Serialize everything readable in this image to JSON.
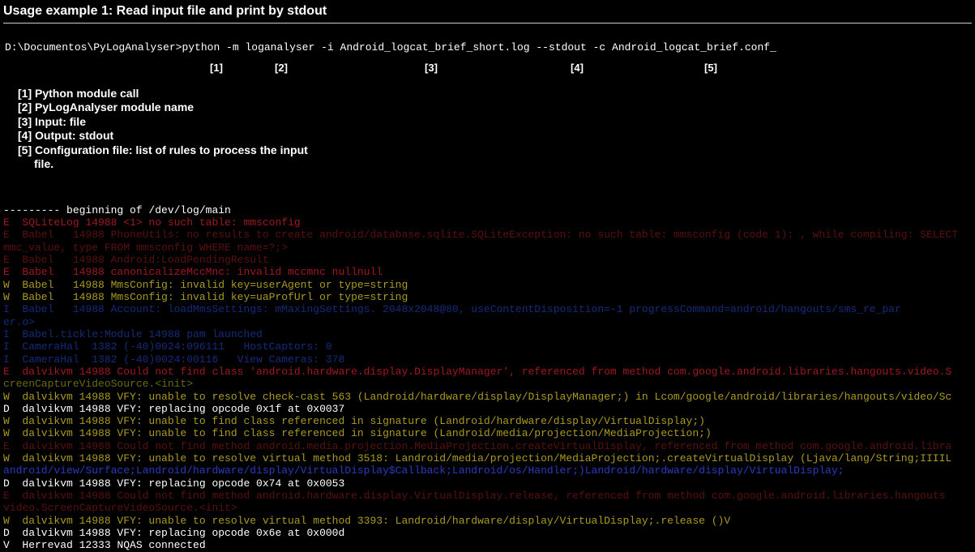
{
  "title": "Usage example 1: Read input file and print by stdout",
  "command": {
    "prompt": "D:\\Documentos\\PyLogAnalyser>",
    "part1": "python -m",
    "part2": "loganalyser",
    "part3": "-i Android_logcat_brief_short.log",
    "part4": "--stdout",
    "part5": "-c Android_logcat_brief.conf",
    "cursor": "_"
  },
  "markers": {
    "m1": "[1]",
    "m2": "[2]",
    "m3": "[3]",
    "m4": "[4]",
    "m5": "[5]"
  },
  "legend": {
    "l1": "[1] Python module call",
    "l2": "[2] PyLogAnalyser module name",
    "l3": "[3] Input: file",
    "l4": "[4] Output: stdout",
    "l5": "[5] Configuration file: list of rules to process the input",
    "l5b": "file."
  },
  "log": [
    {
      "cls": "lg-white",
      "text": "--------- beginning of /dev/log/main"
    },
    {
      "cls": "lg-red",
      "text": "E  SQLiteLog 14988 <1> no such table: mmsconfig"
    },
    {
      "cls": "lg-darkred",
      "text": "E  Babel   14988 PhoneUtils: no results to create android/database.sqlite.SQLiteException: no such table: mmsconfig (code 1): , while compiling: SELECT"
    },
    {
      "cls": "lg-darkred",
      "text": "mmc_value, type FROM mmsconfig WHERE name=?;>"
    },
    {
      "cls": "lg-darkred",
      "text": "E  Babel   14988 Android:LoadPendingResult"
    },
    {
      "cls": "lg-red",
      "text": "E  Babel   14988 canonicalizeMccMnc: invalid mccmnc nullnull"
    },
    {
      "cls": "lg-yellow",
      "text": "W  Babel   14988 MmsConfig: invalid key=userAgent or type=string"
    },
    {
      "cls": "lg-yellow",
      "text": "W  Babel   14988 MmsConfig: invalid key=uaProfUrl or type=string"
    },
    {
      "cls": "lg-dkblue",
      "text": "I  Babel   14988 Account: loadMmsSettings: mMaxingSettings. 2048x2048@80, useContentDisposition=-1 progressCommand=android/hangouts/sms_re_par"
    },
    {
      "cls": "lg-dkblue",
      "text": "er.o>"
    },
    {
      "cls": "lg-dkblue",
      "text": "I  Babel.tickle:Module 14988 pam launched"
    },
    {
      "cls": "lg-dkblue",
      "text": "I  CameraHal  1382 (-40)0024:096111   HostCaptors: 0"
    },
    {
      "cls": "lg-dkblue",
      "text": "I  CameraHal  1382 (-40)0024:00116   View Cameras: 378"
    },
    {
      "cls": "lg-red",
      "text": "E  dalvikvm 14988 Could not find class 'android.hardware.display.DisplayManager', referenced from method com.google.android.libraries.hangouts.video.S"
    },
    {
      "cls": "lg-olive",
      "text": "creenCaptureVideoSource.<init>"
    },
    {
      "cls": "lg-yellow",
      "text": "W  dalvikvm 14988 VFY: unable to resolve check-cast 563 (Landroid/hardware/display/DisplayManager;) in Lcom/google/android/libraries/hangouts/video/Sc"
    },
    {
      "cls": "lg-white",
      "text": "D  dalvikvm 14988 VFY: replacing opcode 0x1f at 0x0037"
    },
    {
      "cls": "lg-yellow",
      "text": "W  dalvikvm 14988 VFY: unable to find class referenced in signature (Landroid/hardware/display/VirtualDisplay;)"
    },
    {
      "cls": "lg-yellow",
      "text": "W  dalvikvm 14988 VFY: unable to find class referenced in signature (Landroid/media/projection/MediaProjection;)"
    },
    {
      "cls": "lg-darkred",
      "text": "E  dalvikvm 14988 Could not find method android.media.projection.MediaProjection.createVirtualDisplay, referenced from method com.google.android.libra"
    },
    {
      "cls": "lg-yellow",
      "text": "W  dalvikvm 14988 VFY: unable to resolve virtual method 3518: Landroid/media/projection/MediaProjection;.createVirtualDisplay (Ljava/lang/String;IIIIL"
    },
    {
      "cls": "lg-blue",
      "text": "android/view/Surface;Landroid/hardware/display/VirtualDisplay$Callback;Landroid/os/Handler;)Landroid/hardware/display/VirtualDisplay;"
    },
    {
      "cls": "lg-white",
      "text": "D  dalvikvm 14988 VFY: replacing opcode 0x74 at 0x0053"
    },
    {
      "cls": "lg-darkred",
      "text": "E  dalvikvm 14988 Could not find method android.hardware.display.VirtualDisplay.release, referenced from method com.google.android.libraries.hangouts"
    },
    {
      "cls": "lg-darkred",
      "text": "video.ScreenCaptureVideoSource.<init>"
    },
    {
      "cls": "lg-yellow",
      "text": "W  dalvikvm 14988 VFY: unable to resolve virtual method 3393: Landroid/hardware/display/VirtualDisplay;.release ()V"
    },
    {
      "cls": "lg-white",
      "text": "D  dalvikvm 14988 VFY: replacing opcode 0x6e at 0x000d"
    },
    {
      "cls": "lg-white",
      "text": "V  Herrevad 12333 NQAS connected"
    }
  ]
}
